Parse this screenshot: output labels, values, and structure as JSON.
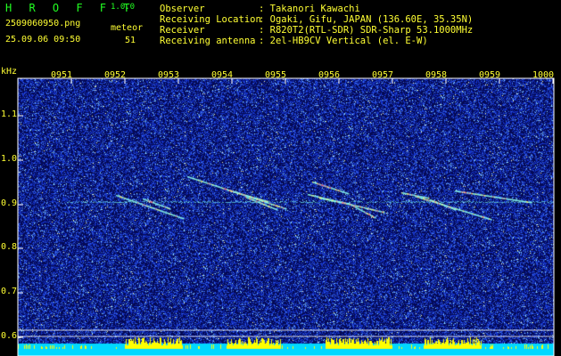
{
  "header": {
    "app_title": "H R O F F T",
    "app_version": "1.0.0",
    "file_name": "2509060950.png",
    "date_time": "25.09.06 09:50",
    "meteor_label": "meteor",
    "meteor_count": "51"
  },
  "info": [
    {
      "key": "Observer",
      "value": ": Takanori Kawachi"
    },
    {
      "key": "Receiving Location",
      "value": ": Ogaki, Gifu, JAPAN (136.60E, 35.35N)"
    },
    {
      "key": "Receiver",
      "value": ": R820T2(RTL-SDR) SDR-Sharp 53.1000MHz"
    },
    {
      "key": "Receiving antenna",
      "value": ": 2el-HB9CV Vertical (el. E-W)"
    }
  ],
  "axis": {
    "unit_label": "kHz",
    "y_ticks": [
      "1.1",
      "1.0",
      "0.9",
      "0.8",
      "0.7",
      "0.6"
    ],
    "x_ticks": [
      "0951",
      "0952",
      "0953",
      "0954",
      "0955",
      "0956",
      "0957",
      "0958",
      "0959",
      "1000"
    ]
  },
  "colors": {
    "label_green": "#22ff22",
    "label_yellow": "#ffff33",
    "noise_blue": "#1c3fd0",
    "carrier_cyan": "#66ffee",
    "baseline_cyan": "#00d8ff",
    "echo_yellow": "#ffff00"
  }
}
